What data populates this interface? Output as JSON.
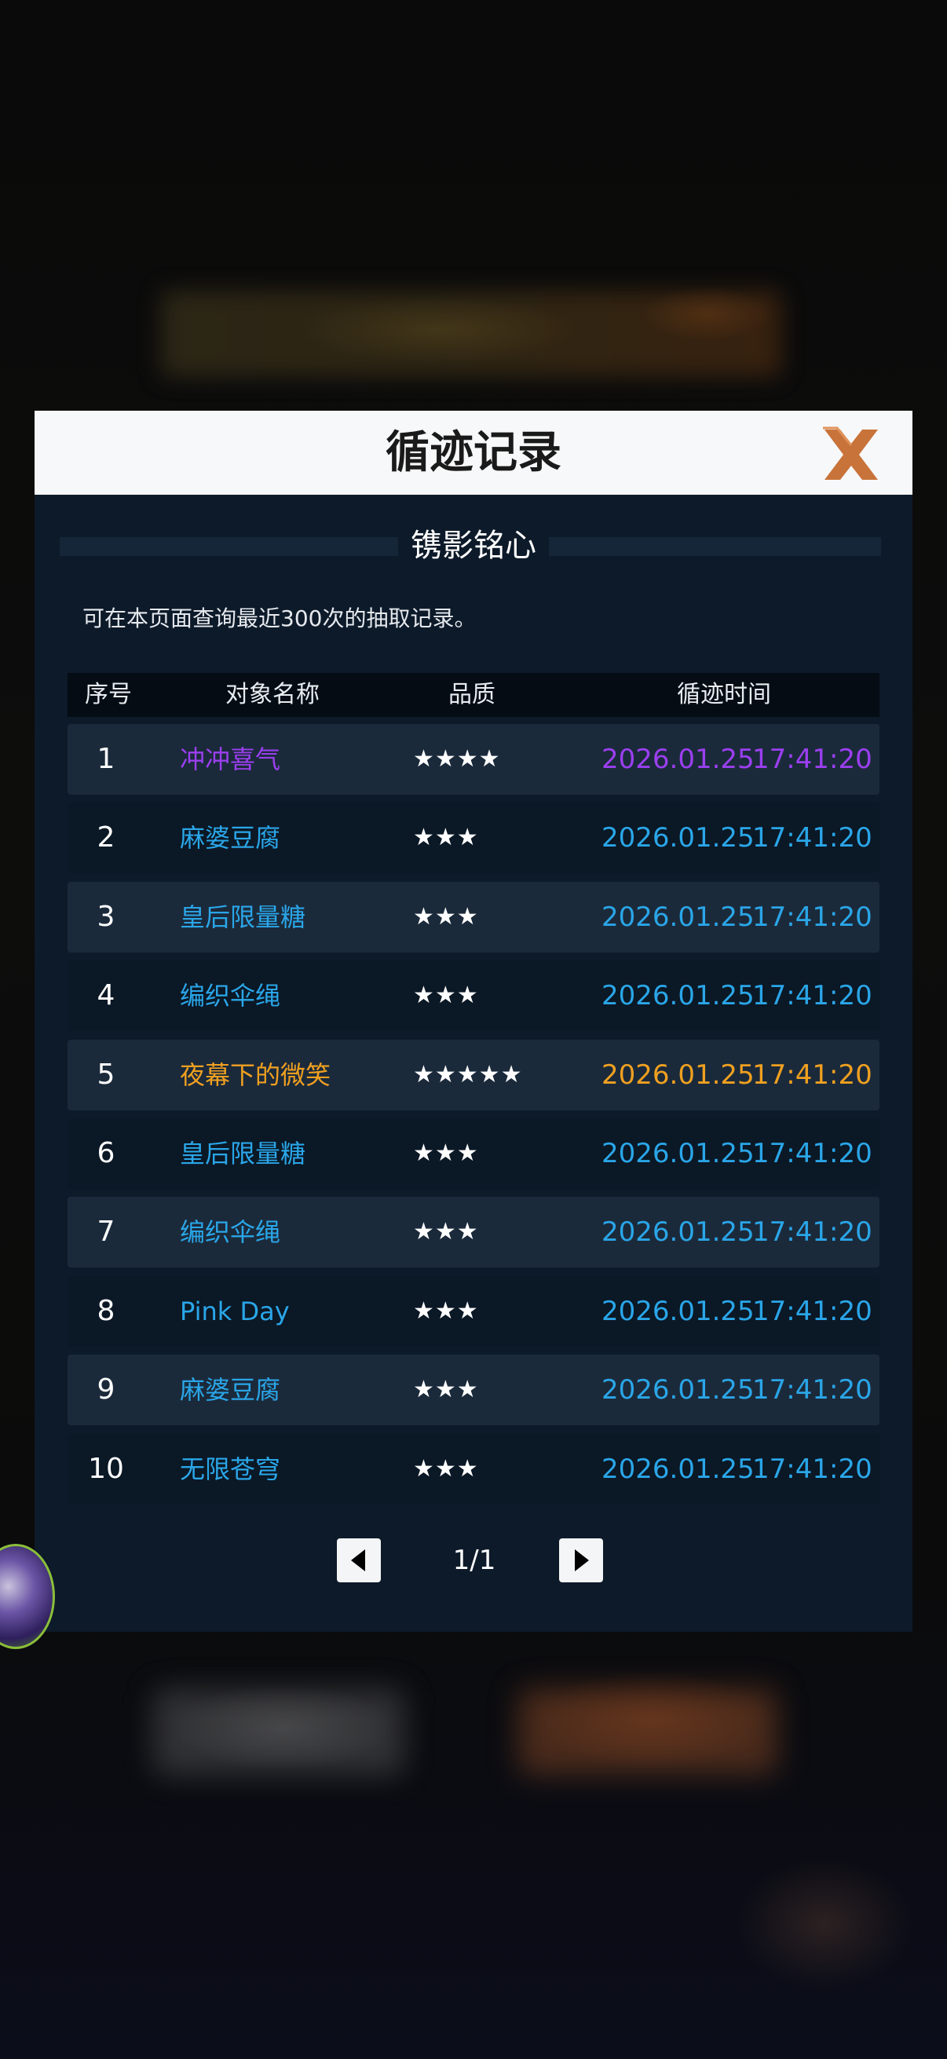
{
  "modal": {
    "title": "循迹记录",
    "subtitle": "镌影铭心",
    "note": "可在本页面查询最近300次的抽取记录。"
  },
  "table": {
    "headers": [
      "序号",
      "对象名称",
      "品质",
      "循迹时间"
    ],
    "rows": [
      {
        "index": "1",
        "name": "冲冲喜气",
        "stars": "★★★★",
        "date": "2026.01.25",
        "time": "17:41:20",
        "color": "#9b3ff0"
      },
      {
        "index": "2",
        "name": "麻婆豆腐",
        "stars": "★★★",
        "date": "2026.01.25",
        "time": "17:41:20",
        "color": "#2aa6e8"
      },
      {
        "index": "3",
        "name": "皇后限量糖",
        "stars": "★★★",
        "date": "2026.01.25",
        "time": "17:41:20",
        "color": "#2aa6e8"
      },
      {
        "index": "4",
        "name": "编织伞绳",
        "stars": "★★★",
        "date": "2026.01.25",
        "time": "17:41:20",
        "color": "#2aa6e8"
      },
      {
        "index": "5",
        "name": "夜幕下的微笑",
        "stars": "★★★★★",
        "date": "2026.01.25",
        "time": "17:41:20",
        "color": "#f0a020"
      },
      {
        "index": "6",
        "name": "皇后限量糖",
        "stars": "★★★",
        "date": "2026.01.25",
        "time": "17:41:20",
        "color": "#2aa6e8"
      },
      {
        "index": "7",
        "name": "编织伞绳",
        "stars": "★★★",
        "date": "2026.01.25",
        "time": "17:41:20",
        "color": "#2aa6e8"
      },
      {
        "index": "8",
        "name": "Pink Day",
        "stars": "★★★",
        "date": "2026.01.25",
        "time": "17:41:20",
        "color": "#2aa6e8"
      },
      {
        "index": "9",
        "name": "麻婆豆腐",
        "stars": "★★★",
        "date": "2026.01.25",
        "time": "17:41:20",
        "color": "#2aa6e8"
      },
      {
        "index": "10",
        "name": "无限苍穹",
        "stars": "★★★",
        "date": "2026.01.25",
        "time": "17:41:20",
        "color": "#2aa6e8"
      }
    ]
  },
  "pager": {
    "label": "1/1"
  },
  "icons": {
    "close": "close-icon",
    "prev": "triangle-left-icon",
    "next": "triangle-right-icon"
  },
  "colors": {
    "header_bg": "#f7f8f9",
    "panel_bg": "#0d1a29",
    "close_x": "#c8733a",
    "rarity_4": "#9b3ff0",
    "rarity_5": "#f0a020",
    "rarity_3": "#2aa6e8"
  }
}
